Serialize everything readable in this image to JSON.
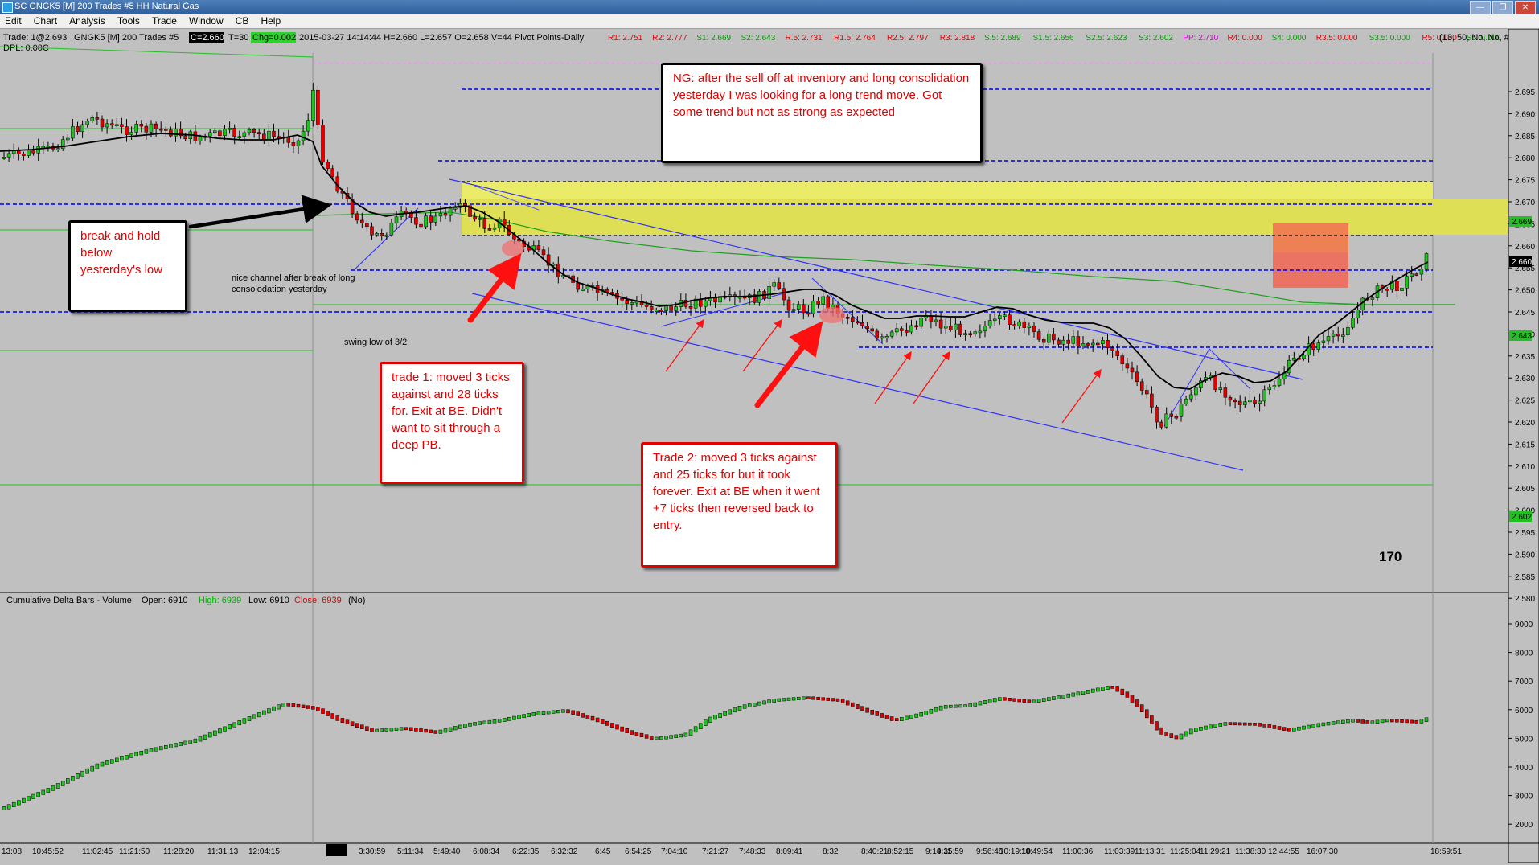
{
  "window": {
    "title": "SC GNGK5 [M]  200 Trades  #5  HH Natural Gas",
    "buttons": [
      "—",
      "❐",
      "✕"
    ]
  },
  "menu": [
    "Edit",
    "Chart",
    "Analysis",
    "Tools",
    "Trade",
    "Window",
    "CB",
    "Help"
  ],
  "header": {
    "trade_label": "Trade: 1@2.693",
    "symbol_label": "GNGK5 [M]  200 Trades  #5",
    "close_box": "C=2.660",
    "t_label": "T=30",
    "chg_box": "Chg=0.002",
    "stats": "2015-03-27 14:14:44 H=2.660 L=2.657 O=2.658 V=44 Pivot Points-Daily",
    "pivots": [
      {
        "text": "R1: 2.751",
        "color": "#e00000"
      },
      {
        "text": "R2: 2.777",
        "color": "#e00000"
      },
      {
        "text": "S1: 2.669",
        "color": "#00a000"
      },
      {
        "text": "S2: 2.643",
        "color": "#00a000"
      },
      {
        "text": "R.5: 2.731",
        "color": "#e00000"
      },
      {
        "text": "R1.5: 2.764",
        "color": "#e00000"
      },
      {
        "text": "R2.5: 2.797",
        "color": "#e00000"
      },
      {
        "text": "R3: 2.818",
        "color": "#e00000"
      },
      {
        "text": "S.5: 2.689",
        "color": "#00a000"
      },
      {
        "text": "S1.5: 2.656",
        "color": "#00a000"
      },
      {
        "text": "S2.5: 2.623",
        "color": "#00a000"
      },
      {
        "text": "S3: 2.602",
        "color": "#00a000"
      },
      {
        "text": "PP: 2.710",
        "color": "#d000d0"
      },
      {
        "text": "R4: 0.000",
        "color": "#e00000"
      },
      {
        "text": "S4: 0.000",
        "color": "#00a000"
      },
      {
        "text": "R3.5: 0.000",
        "color": "#e00000"
      },
      {
        "text": "S3.5: 0.000",
        "color": "#00a000"
      },
      {
        "text": "R5: 0.000",
        "color": "#e00000"
      },
      {
        "text": "S5: 0.000",
        "color": "#00a000"
      }
    ],
    "tail": "(13, 50, No, No, #",
    "dpl": "DPL: 0.00C"
  },
  "price_axis": {
    "ticks": [
      "2.695",
      "2.690",
      "2.685",
      "2.680",
      "2.675",
      "2.670",
      "2.665",
      "2.660",
      "2.655",
      "2.650",
      "2.645",
      "2.640",
      "2.635",
      "2.630",
      "2.625",
      "2.620",
      "2.615",
      "2.610",
      "2.605",
      "2.600",
      "2.595",
      "2.590",
      "2.585",
      "2.580"
    ],
    "tags": [
      {
        "text": "2.669",
        "bg": "#22c022"
      },
      {
        "text": "2.660",
        "bg": "#000000"
      },
      {
        "text": "2.643",
        "bg": "#22c022"
      },
      {
        "text": "2.602",
        "bg": "#22c022"
      }
    ]
  },
  "delta_panel": {
    "label": "Cumulative Delta Bars - Volume",
    "open": "Open: 6910",
    "high": "High: 6939",
    "low": "Low: 6910",
    "close": "Close: 6939",
    "flag": "(No)",
    "ticks": [
      "9000",
      "8000",
      "7000",
      "6000",
      "5000",
      "4000",
      "3000",
      "2000"
    ]
  },
  "time_axis": {
    "labels": [
      "13:08",
      "10:45:52",
      "11:02:45",
      "11:21:50",
      "11:28:20",
      "11:31:13",
      "12:04:15",
      "3-27",
      "3:30:59",
      "5:11:34",
      "5:49:40",
      "6:08:34",
      "6:22:35",
      "6:32:32",
      "6:45",
      "6:54:25",
      "7:04:10",
      "7:21:27",
      "7:48:33",
      "8:09:41",
      "8:32",
      "8:40:21",
      "8:52:15",
      "9:14:11",
      "9:35:59",
      "9:56:48",
      "10:19:10",
      "10:49:54",
      "11:00:36",
      "11:03:39",
      "11:13:31",
      "11:25:04",
      "11:29:21",
      "11:38:30",
      "12:44:55",
      "16:07:30",
      "18:59:51"
    ]
  },
  "annotations": {
    "ng_note": "NG: after the sell off at inventory and long consolidation yesterday I was looking for a long trend move.  Got some trend but not as strong as expected",
    "break_note": "break and hold below yesterday's low",
    "trade1_note": "trade 1:  moved 3 ticks against and 28 ticks for.  Exit at BE. Didn't want to sit through a deep PB.",
    "trade2_note": "Trade 2:  moved 3 ticks against and 25 ticks for but it took forever.  Exit at BE when it went +7 ticks then reversed back to entry.",
    "channel_note": "nice channel after break of long consolodation yesterday",
    "swing_note": "swing low of 3/2",
    "count": "170"
  },
  "colors": {
    "chart_bg": "#c0c0c0",
    "up_candle": "#22c022",
    "down_candle": "#e00000",
    "level_line": "#0000e0",
    "zone_yellow": "#e8e85a",
    "trend_line": "#3030ff"
  }
}
